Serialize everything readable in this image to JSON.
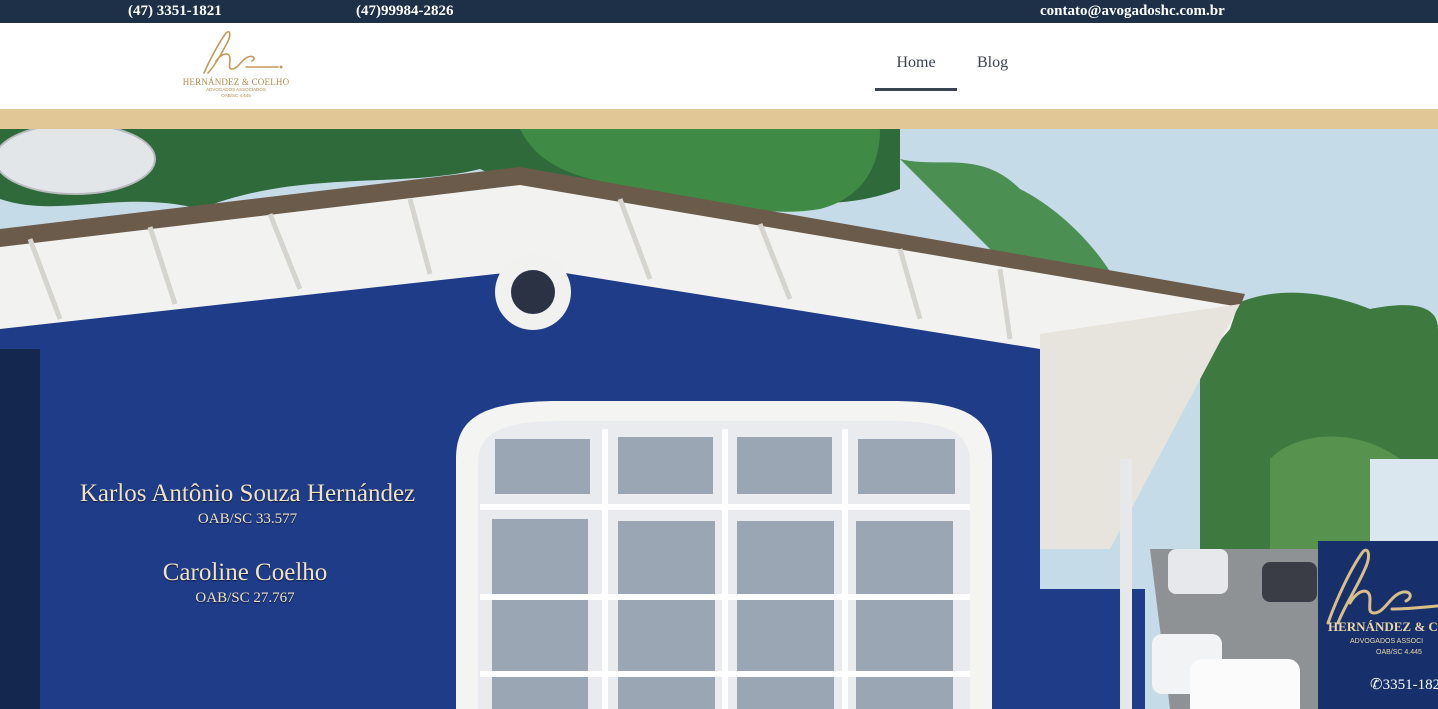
{
  "topbar": {
    "phone1": "(47) 3351-1821",
    "phone2": "(47)99984-2826",
    "email": "contato@avogadoshc.com.br",
    "background": "#1e3048"
  },
  "header": {
    "logo": {
      "monogram": "hc",
      "firm_name": "HERNÁNDEZ & COELHO",
      "tagline": "ADVOGADOS ASSOCIADOS",
      "registration": "OAB/SC 4.445",
      "color": "#b08a4e"
    },
    "nav": [
      {
        "label": "Home",
        "active": true
      },
      {
        "label": "Blog",
        "active": false
      }
    ]
  },
  "stripe_color": "#e2c796",
  "hero": {
    "sign_lines": [
      {
        "name": "Karlos Antônio Souza Hernández",
        "oab": "OAB/SC 33.577"
      },
      {
        "name": "Caroline Coelho",
        "oab": "OAB/SC 27.767"
      }
    ],
    "panel": {
      "firm_name": "HERNÁNDEZ & C",
      "tagline": "ADVOGADOS ASSOCI",
      "registration": "OAB/SC 4.445",
      "phone": "3351-182"
    }
  }
}
